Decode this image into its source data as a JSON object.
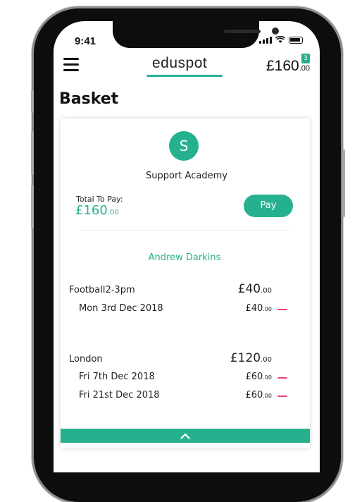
{
  "status_bar": {
    "time": "9:41"
  },
  "header": {
    "logo": "eduspot",
    "amount_main": "£160",
    "amount_pence": ".00",
    "cart_count": "3"
  },
  "page_title": "Basket",
  "school": {
    "avatar_letter": "S",
    "name": "Support Academy"
  },
  "total": {
    "label": "Total To Pay:",
    "amount_main": "£160",
    "amount_pence": ".00"
  },
  "pay_label": "Pay",
  "student": "Andrew Darkins",
  "activities": [
    {
      "name": "Football2-3pm",
      "total_main": "£40",
      "total_pence": ".00",
      "sessions": [
        {
          "date": "Mon 3rd Dec 2018",
          "price_main": "£40",
          "price_pence": ".00"
        }
      ]
    },
    {
      "name": "London",
      "total_main": "£120",
      "total_pence": ".00",
      "sessions": [
        {
          "date": "Fri 7th Dec 2018",
          "price_main": "£60",
          "price_pence": ".00"
        },
        {
          "date": "Fri 21st Dec 2018",
          "price_main": "£60",
          "price_pence": ".00"
        }
      ]
    }
  ],
  "colors": {
    "accent": "#25b18f",
    "remove": "#e8436b"
  },
  "icons": {
    "menu": "hamburger-menu-icon",
    "collapse": "chevron-up-icon",
    "remove": "minus-icon"
  }
}
